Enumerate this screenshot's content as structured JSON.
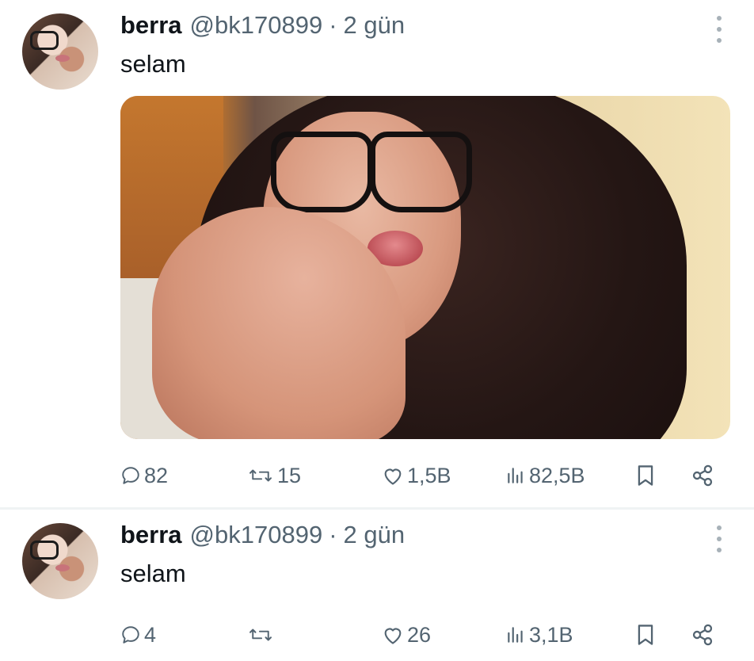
{
  "tweets": [
    {
      "user": {
        "name": "berra",
        "handle": "@bk170899"
      },
      "separator": "·",
      "time": "2 gün",
      "text": "selam",
      "has_media": true,
      "stats": {
        "replies": "82",
        "retweets": "15",
        "likes": "1,5B",
        "views": "82,5B"
      }
    },
    {
      "user": {
        "name": "berra",
        "handle": "@bk170899"
      },
      "separator": "·",
      "time": "2 gün",
      "text": "selam",
      "has_media": false,
      "stats": {
        "replies": "4",
        "retweets": "",
        "likes": "26",
        "views": "3,1B"
      }
    }
  ],
  "icons": {
    "reply": "speech-bubble-icon",
    "retweet": "retweet-arrows-icon",
    "like": "heart-icon",
    "views": "bar-chart-icon",
    "bookmark": "bookmark-icon",
    "share": "share-icon",
    "more": "vertical-ellipsis-icon"
  },
  "colors": {
    "text": "#0f1419",
    "muted": "#536471",
    "divider": "#eff3f4"
  }
}
